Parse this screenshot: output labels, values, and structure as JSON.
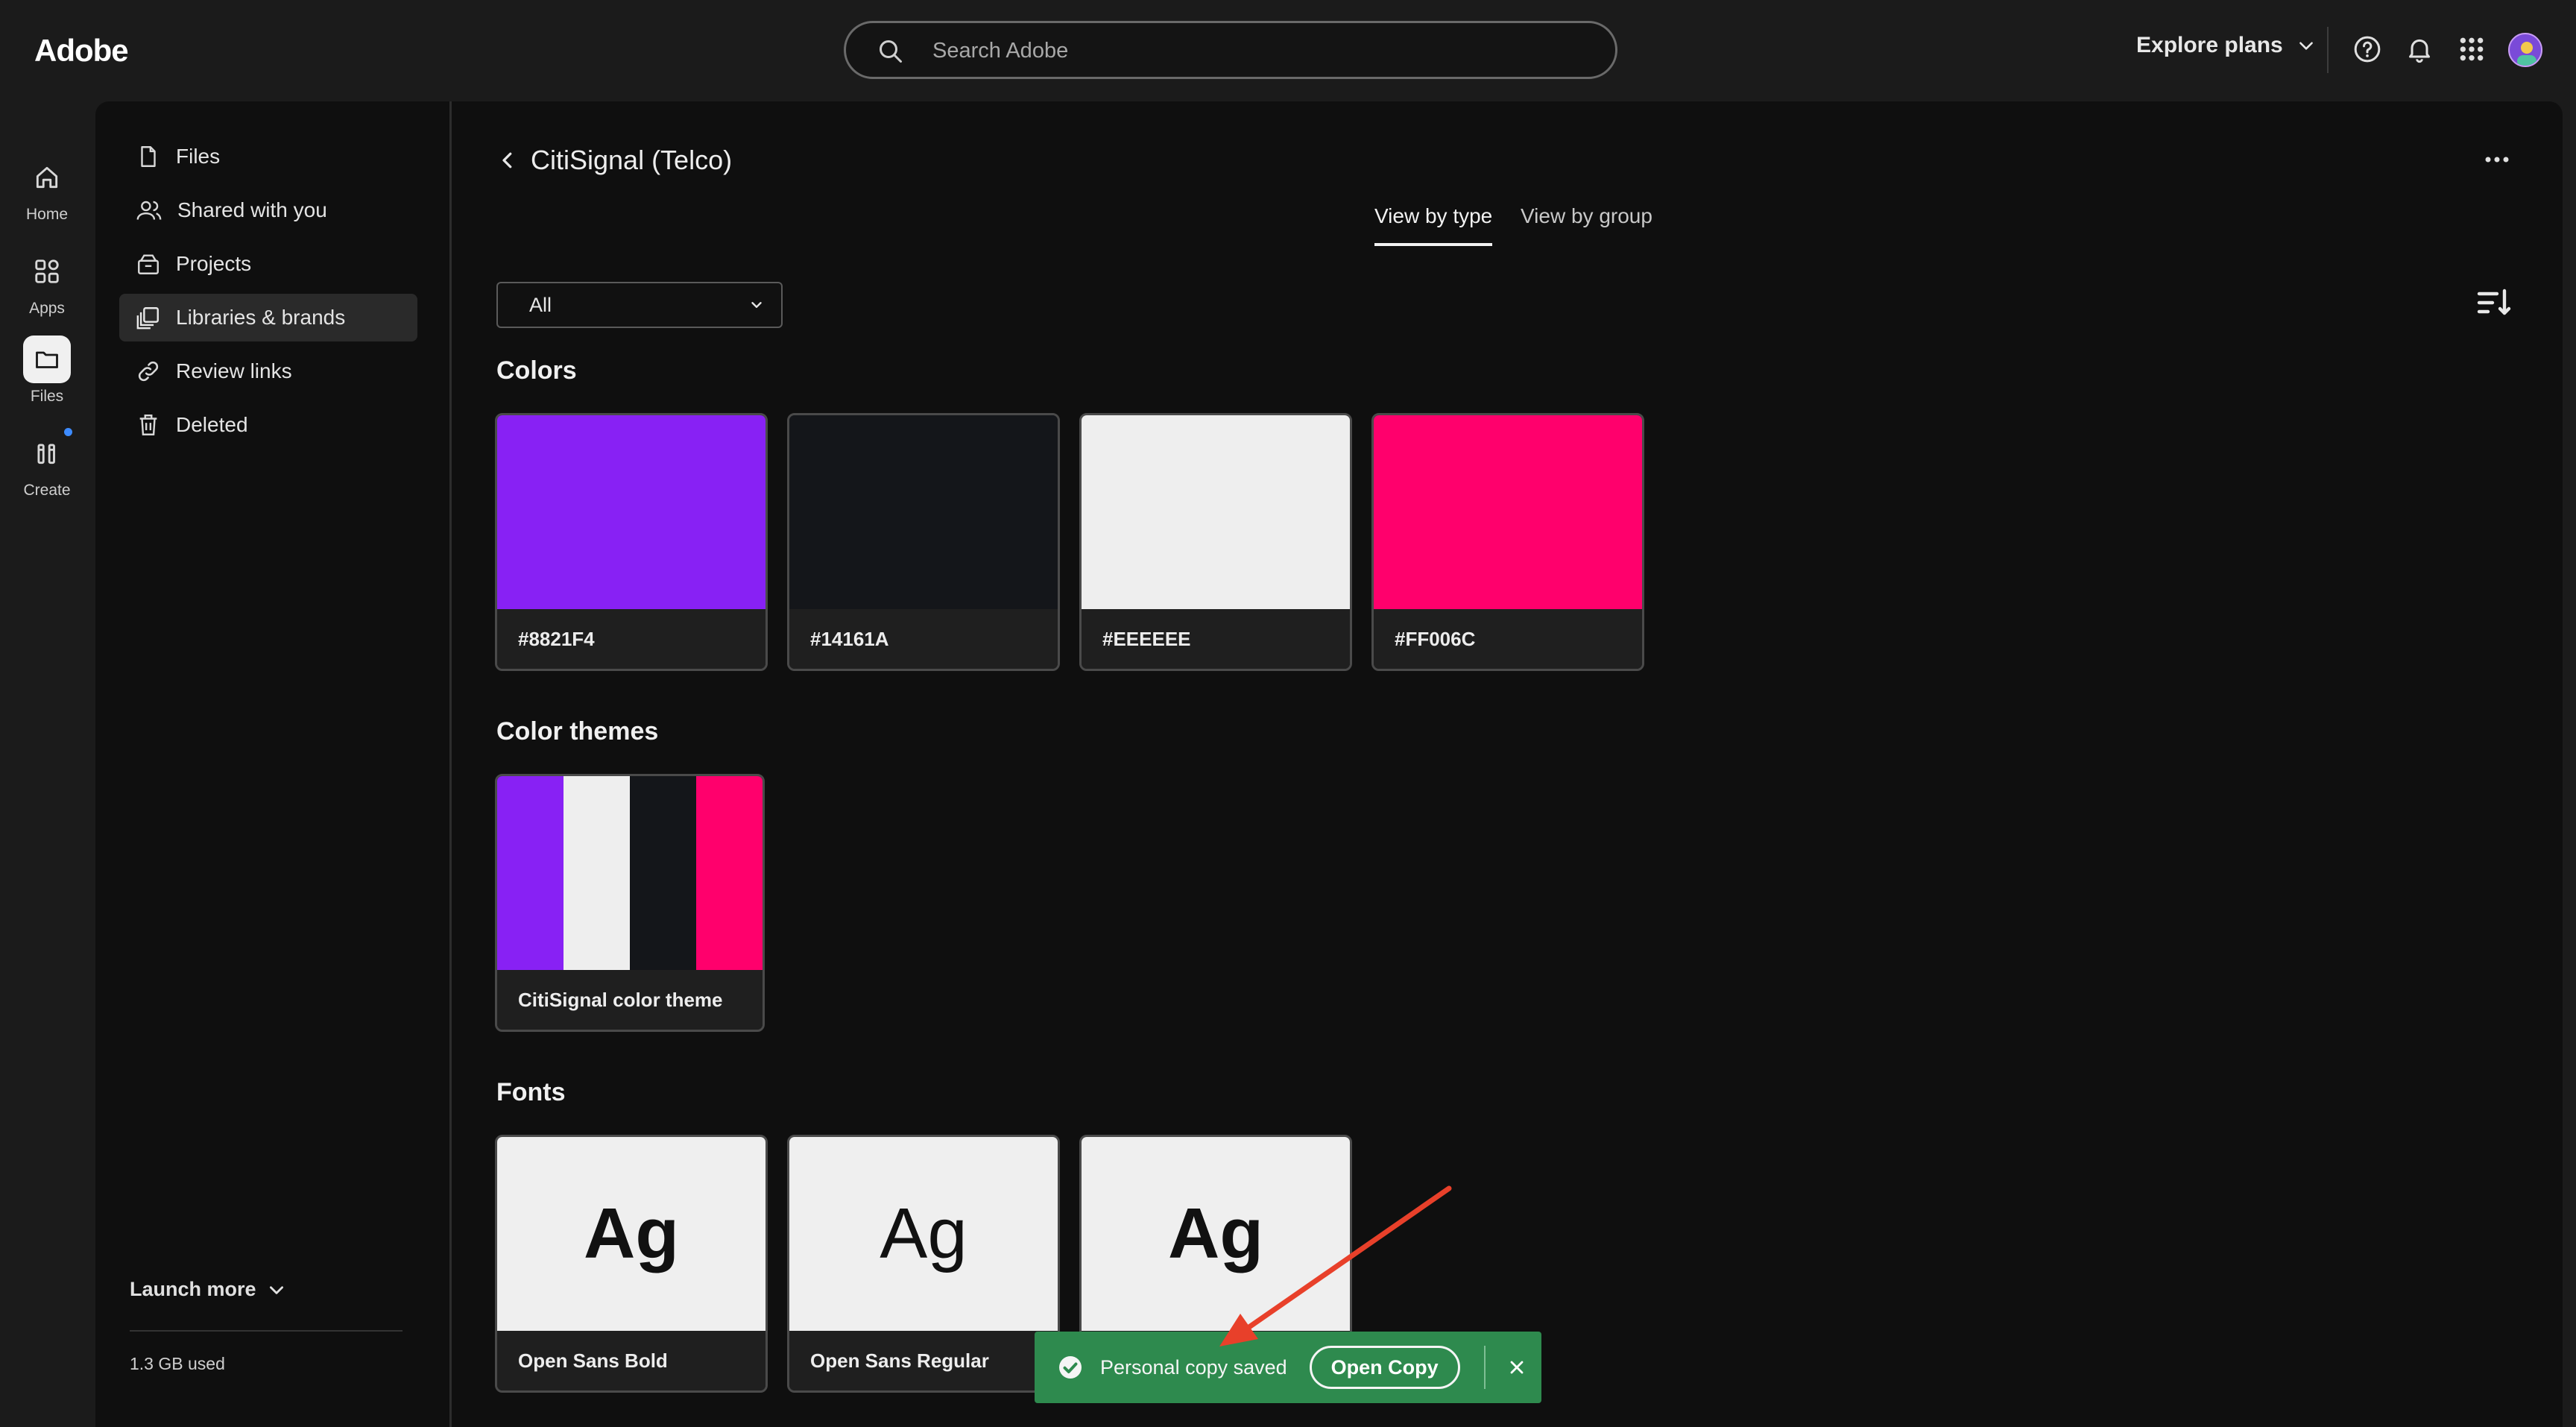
{
  "topbar": {
    "logo": "Adobe",
    "search_placeholder": "Search Adobe",
    "explore_label": "Explore plans"
  },
  "rail": {
    "items": [
      {
        "label": "Home",
        "icon": "home-icon"
      },
      {
        "label": "Apps",
        "icon": "apps-icon"
      },
      {
        "label": "Files",
        "icon": "folder-icon"
      },
      {
        "label": "Create",
        "icon": "create-icon"
      }
    ]
  },
  "sidenav": {
    "items": [
      {
        "label": "Files",
        "icon": "file-icon"
      },
      {
        "label": "Shared with you",
        "icon": "users-icon"
      },
      {
        "label": "Projects",
        "icon": "projects-icon"
      },
      {
        "label": "Libraries & brands",
        "icon": "library-icon"
      },
      {
        "label": "Review links",
        "icon": "link-icon"
      },
      {
        "label": "Deleted",
        "icon": "trash-icon"
      }
    ],
    "launch_more": "Launch more",
    "storage": "1.3 GB used"
  },
  "main": {
    "title": "CitiSignal (Telco)",
    "tabs": [
      {
        "label": "View by type"
      },
      {
        "label": "View by group"
      }
    ],
    "filter_value": "All"
  },
  "colors_section": {
    "heading": "Colors",
    "items": [
      {
        "label": "#8821F4",
        "color": "#8821F4"
      },
      {
        "label": "#14161A",
        "color": "#14161A"
      },
      {
        "label": "#EEEEEE",
        "color": "#EEEEEE"
      },
      {
        "label": "#FF006C",
        "color": "#FF006C"
      }
    ]
  },
  "themes_section": {
    "heading": "Color themes",
    "items": [
      {
        "label": "CitiSignal color theme",
        "colors": [
          "#8821F4",
          "#EEEEEE",
          "#14161A",
          "#FF006C"
        ]
      }
    ]
  },
  "fonts_section": {
    "heading": "Fonts",
    "items": [
      {
        "label": "Open Sans Bold",
        "preview": "Ag"
      },
      {
        "label": "Open Sans Regular",
        "preview": "Ag"
      },
      {
        "label": "",
        "preview": "Ag"
      }
    ]
  },
  "toast": {
    "message": "Personal copy saved",
    "action": "Open Copy"
  }
}
